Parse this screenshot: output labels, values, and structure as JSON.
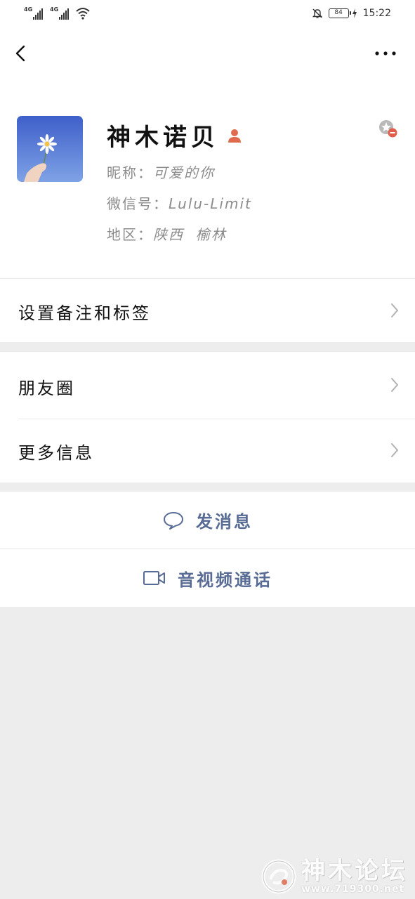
{
  "status_bar": {
    "net1": "4G",
    "net2": "4G",
    "battery": "84",
    "time": "15:22"
  },
  "profile": {
    "name": "神木诺贝",
    "nickname_label": "昵称：",
    "nickname": "可爱的你",
    "wechat_id_label": "微信号：",
    "wechat_id": "Lulu-Limit",
    "region_label": "地区：",
    "region": "陕西  榆林",
    "gender_icon": "female-icon",
    "star_icon": "star-friend-icon"
  },
  "cells": {
    "remark_tags": "设置备注和标签",
    "moments": "朋友圈",
    "more_info": "更多信息"
  },
  "actions": {
    "send_message": "发消息",
    "video_call": "音视频通话"
  },
  "watermark": {
    "title": "神木论坛",
    "url": "www.719300.net"
  },
  "colors": {
    "link": "#576b95",
    "background": "#ededed",
    "gender": "#e06a4e"
  }
}
